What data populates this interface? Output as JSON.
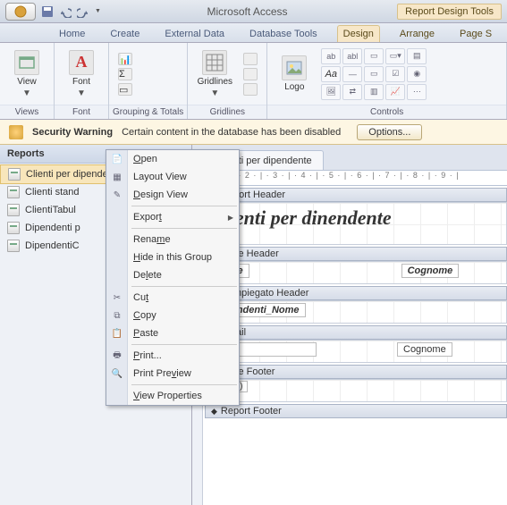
{
  "titlebar": {
    "app_title": "Microsoft Access",
    "contextual_title": "Report Design Tools"
  },
  "tabs": {
    "home": "Home",
    "create": "Create",
    "external": "External Data",
    "dbtools": "Database Tools",
    "design": "Design",
    "arrange": "Arrange",
    "pagesetup": "Page S"
  },
  "ribbon": {
    "views": {
      "label": "Views",
      "view_btn": "View"
    },
    "font": {
      "label": "Font",
      "font_btn": "Font"
    },
    "grouping": {
      "label": "Grouping & Totals"
    },
    "gridlines": {
      "label": "Gridlines",
      "btn": "Gridlines"
    },
    "logo": {
      "btn": "Logo"
    },
    "controls": {
      "label": "Controls"
    }
  },
  "security": {
    "title": "Security Warning",
    "msg": "Certain content in the database has been disabled",
    "options": "Options..."
  },
  "navpane": {
    "header": "Reports",
    "items": [
      "Clienti per dipendente",
      "Clienti stand",
      "ClientiTabul",
      "Dipendenti p",
      "DipendentiC"
    ]
  },
  "context_menu": {
    "open": "Open",
    "layout": "Layout View",
    "design": "Design View",
    "export": "Export",
    "rename": "Rename",
    "hide": "Hide in this Group",
    "delete": "Delete",
    "cut": "Cut",
    "copy": "Copy",
    "paste": "Paste",
    "print": "Print...",
    "preview": "Print Preview",
    "props": "View Properties"
  },
  "design_surface": {
    "doc_tab": "ienti per dipendente",
    "ruler": "· 1 · | · 2 · | · 3 · | · 4 · | · 5 · | · 6 · | · 7 · | · 8 · | · 9 · |",
    "sections": {
      "report_header": "Report Header",
      "page_header": "Page Header",
      "group_header": "IDImpiegato Header",
      "detail": "Detail",
      "page_footer": "Page Footer",
      "report_footer": "Report Footer"
    },
    "title": "Clienti per dinendente",
    "col_nome": "Nome",
    "col_cognome": "Cognome",
    "group_field": "Dipendenti_Nome",
    "detail_cognome": "Cognome",
    "now_fn": "=Now()"
  }
}
